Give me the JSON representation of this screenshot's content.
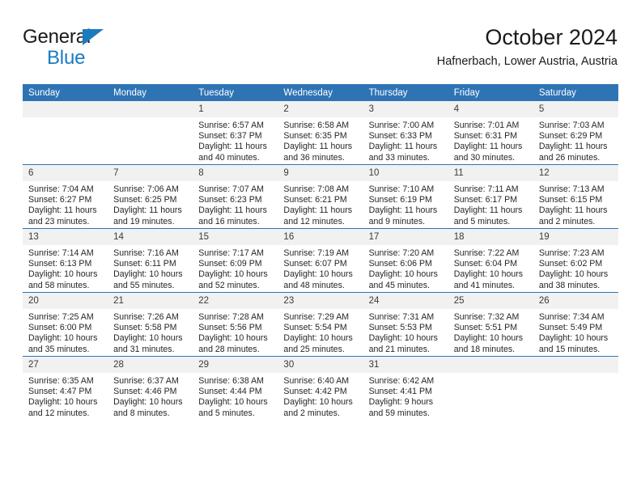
{
  "brand": {
    "name_line1": "General",
    "name_line2": "Blue",
    "triangle_icon": "triangle-icon",
    "accent_color": "#1b7bc1"
  },
  "header": {
    "title": "October 2024",
    "subtitle": "Hafnerbach, Lower Austria, Austria"
  },
  "theme": {
    "header_blue": "#2e74b5",
    "daynum_band": "#f1f1f1",
    "text": "#262626"
  },
  "weekday_headers": [
    "Sunday",
    "Monday",
    "Tuesday",
    "Wednesday",
    "Thursday",
    "Friday",
    "Saturday"
  ],
  "weeks": [
    [
      {
        "day": "",
        "sunrise": "",
        "sunset": "",
        "daylight_line1": "",
        "daylight_line2": ""
      },
      {
        "day": "",
        "sunrise": "",
        "sunset": "",
        "daylight_line1": "",
        "daylight_line2": ""
      },
      {
        "day": "1",
        "sunrise": "Sunrise: 6:57 AM",
        "sunset": "Sunset: 6:37 PM",
        "daylight_line1": "Daylight: 11 hours",
        "daylight_line2": "and 40 minutes."
      },
      {
        "day": "2",
        "sunrise": "Sunrise: 6:58 AM",
        "sunset": "Sunset: 6:35 PM",
        "daylight_line1": "Daylight: 11 hours",
        "daylight_line2": "and 36 minutes."
      },
      {
        "day": "3",
        "sunrise": "Sunrise: 7:00 AM",
        "sunset": "Sunset: 6:33 PM",
        "daylight_line1": "Daylight: 11 hours",
        "daylight_line2": "and 33 minutes."
      },
      {
        "day": "4",
        "sunrise": "Sunrise: 7:01 AM",
        "sunset": "Sunset: 6:31 PM",
        "daylight_line1": "Daylight: 11 hours",
        "daylight_line2": "and 30 minutes."
      },
      {
        "day": "5",
        "sunrise": "Sunrise: 7:03 AM",
        "sunset": "Sunset: 6:29 PM",
        "daylight_line1": "Daylight: 11 hours",
        "daylight_line2": "and 26 minutes."
      }
    ],
    [
      {
        "day": "6",
        "sunrise": "Sunrise: 7:04 AM",
        "sunset": "Sunset: 6:27 PM",
        "daylight_line1": "Daylight: 11 hours",
        "daylight_line2": "and 23 minutes."
      },
      {
        "day": "7",
        "sunrise": "Sunrise: 7:06 AM",
        "sunset": "Sunset: 6:25 PM",
        "daylight_line1": "Daylight: 11 hours",
        "daylight_line2": "and 19 minutes."
      },
      {
        "day": "8",
        "sunrise": "Sunrise: 7:07 AM",
        "sunset": "Sunset: 6:23 PM",
        "daylight_line1": "Daylight: 11 hours",
        "daylight_line2": "and 16 minutes."
      },
      {
        "day": "9",
        "sunrise": "Sunrise: 7:08 AM",
        "sunset": "Sunset: 6:21 PM",
        "daylight_line1": "Daylight: 11 hours",
        "daylight_line2": "and 12 minutes."
      },
      {
        "day": "10",
        "sunrise": "Sunrise: 7:10 AM",
        "sunset": "Sunset: 6:19 PM",
        "daylight_line1": "Daylight: 11 hours",
        "daylight_line2": "and 9 minutes."
      },
      {
        "day": "11",
        "sunrise": "Sunrise: 7:11 AM",
        "sunset": "Sunset: 6:17 PM",
        "daylight_line1": "Daylight: 11 hours",
        "daylight_line2": "and 5 minutes."
      },
      {
        "day": "12",
        "sunrise": "Sunrise: 7:13 AM",
        "sunset": "Sunset: 6:15 PM",
        "daylight_line1": "Daylight: 11 hours",
        "daylight_line2": "and 2 minutes."
      }
    ],
    [
      {
        "day": "13",
        "sunrise": "Sunrise: 7:14 AM",
        "sunset": "Sunset: 6:13 PM",
        "daylight_line1": "Daylight: 10 hours",
        "daylight_line2": "and 58 minutes."
      },
      {
        "day": "14",
        "sunrise": "Sunrise: 7:16 AM",
        "sunset": "Sunset: 6:11 PM",
        "daylight_line1": "Daylight: 10 hours",
        "daylight_line2": "and 55 minutes."
      },
      {
        "day": "15",
        "sunrise": "Sunrise: 7:17 AM",
        "sunset": "Sunset: 6:09 PM",
        "daylight_line1": "Daylight: 10 hours",
        "daylight_line2": "and 52 minutes."
      },
      {
        "day": "16",
        "sunrise": "Sunrise: 7:19 AM",
        "sunset": "Sunset: 6:07 PM",
        "daylight_line1": "Daylight: 10 hours",
        "daylight_line2": "and 48 minutes."
      },
      {
        "day": "17",
        "sunrise": "Sunrise: 7:20 AM",
        "sunset": "Sunset: 6:06 PM",
        "daylight_line1": "Daylight: 10 hours",
        "daylight_line2": "and 45 minutes."
      },
      {
        "day": "18",
        "sunrise": "Sunrise: 7:22 AM",
        "sunset": "Sunset: 6:04 PM",
        "daylight_line1": "Daylight: 10 hours",
        "daylight_line2": "and 41 minutes."
      },
      {
        "day": "19",
        "sunrise": "Sunrise: 7:23 AM",
        "sunset": "Sunset: 6:02 PM",
        "daylight_line1": "Daylight: 10 hours",
        "daylight_line2": "and 38 minutes."
      }
    ],
    [
      {
        "day": "20",
        "sunrise": "Sunrise: 7:25 AM",
        "sunset": "Sunset: 6:00 PM",
        "daylight_line1": "Daylight: 10 hours",
        "daylight_line2": "and 35 minutes."
      },
      {
        "day": "21",
        "sunrise": "Sunrise: 7:26 AM",
        "sunset": "Sunset: 5:58 PM",
        "daylight_line1": "Daylight: 10 hours",
        "daylight_line2": "and 31 minutes."
      },
      {
        "day": "22",
        "sunrise": "Sunrise: 7:28 AM",
        "sunset": "Sunset: 5:56 PM",
        "daylight_line1": "Daylight: 10 hours",
        "daylight_line2": "and 28 minutes."
      },
      {
        "day": "23",
        "sunrise": "Sunrise: 7:29 AM",
        "sunset": "Sunset: 5:54 PM",
        "daylight_line1": "Daylight: 10 hours",
        "daylight_line2": "and 25 minutes."
      },
      {
        "day": "24",
        "sunrise": "Sunrise: 7:31 AM",
        "sunset": "Sunset: 5:53 PM",
        "daylight_line1": "Daylight: 10 hours",
        "daylight_line2": "and 21 minutes."
      },
      {
        "day": "25",
        "sunrise": "Sunrise: 7:32 AM",
        "sunset": "Sunset: 5:51 PM",
        "daylight_line1": "Daylight: 10 hours",
        "daylight_line2": "and 18 minutes."
      },
      {
        "day": "26",
        "sunrise": "Sunrise: 7:34 AM",
        "sunset": "Sunset: 5:49 PM",
        "daylight_line1": "Daylight: 10 hours",
        "daylight_line2": "and 15 minutes."
      }
    ],
    [
      {
        "day": "27",
        "sunrise": "Sunrise: 6:35 AM",
        "sunset": "Sunset: 4:47 PM",
        "daylight_line1": "Daylight: 10 hours",
        "daylight_line2": "and 12 minutes."
      },
      {
        "day": "28",
        "sunrise": "Sunrise: 6:37 AM",
        "sunset": "Sunset: 4:46 PM",
        "daylight_line1": "Daylight: 10 hours",
        "daylight_line2": "and 8 minutes."
      },
      {
        "day": "29",
        "sunrise": "Sunrise: 6:38 AM",
        "sunset": "Sunset: 4:44 PM",
        "daylight_line1": "Daylight: 10 hours",
        "daylight_line2": "and 5 minutes."
      },
      {
        "day": "30",
        "sunrise": "Sunrise: 6:40 AM",
        "sunset": "Sunset: 4:42 PM",
        "daylight_line1": "Daylight: 10 hours",
        "daylight_line2": "and 2 minutes."
      },
      {
        "day": "31",
        "sunrise": "Sunrise: 6:42 AM",
        "sunset": "Sunset: 4:41 PM",
        "daylight_line1": "Daylight: 9 hours",
        "daylight_line2": "and 59 minutes."
      },
      {
        "day": "",
        "sunrise": "",
        "sunset": "",
        "daylight_line1": "",
        "daylight_line2": ""
      },
      {
        "day": "",
        "sunrise": "",
        "sunset": "",
        "daylight_line1": "",
        "daylight_line2": ""
      }
    ]
  ]
}
